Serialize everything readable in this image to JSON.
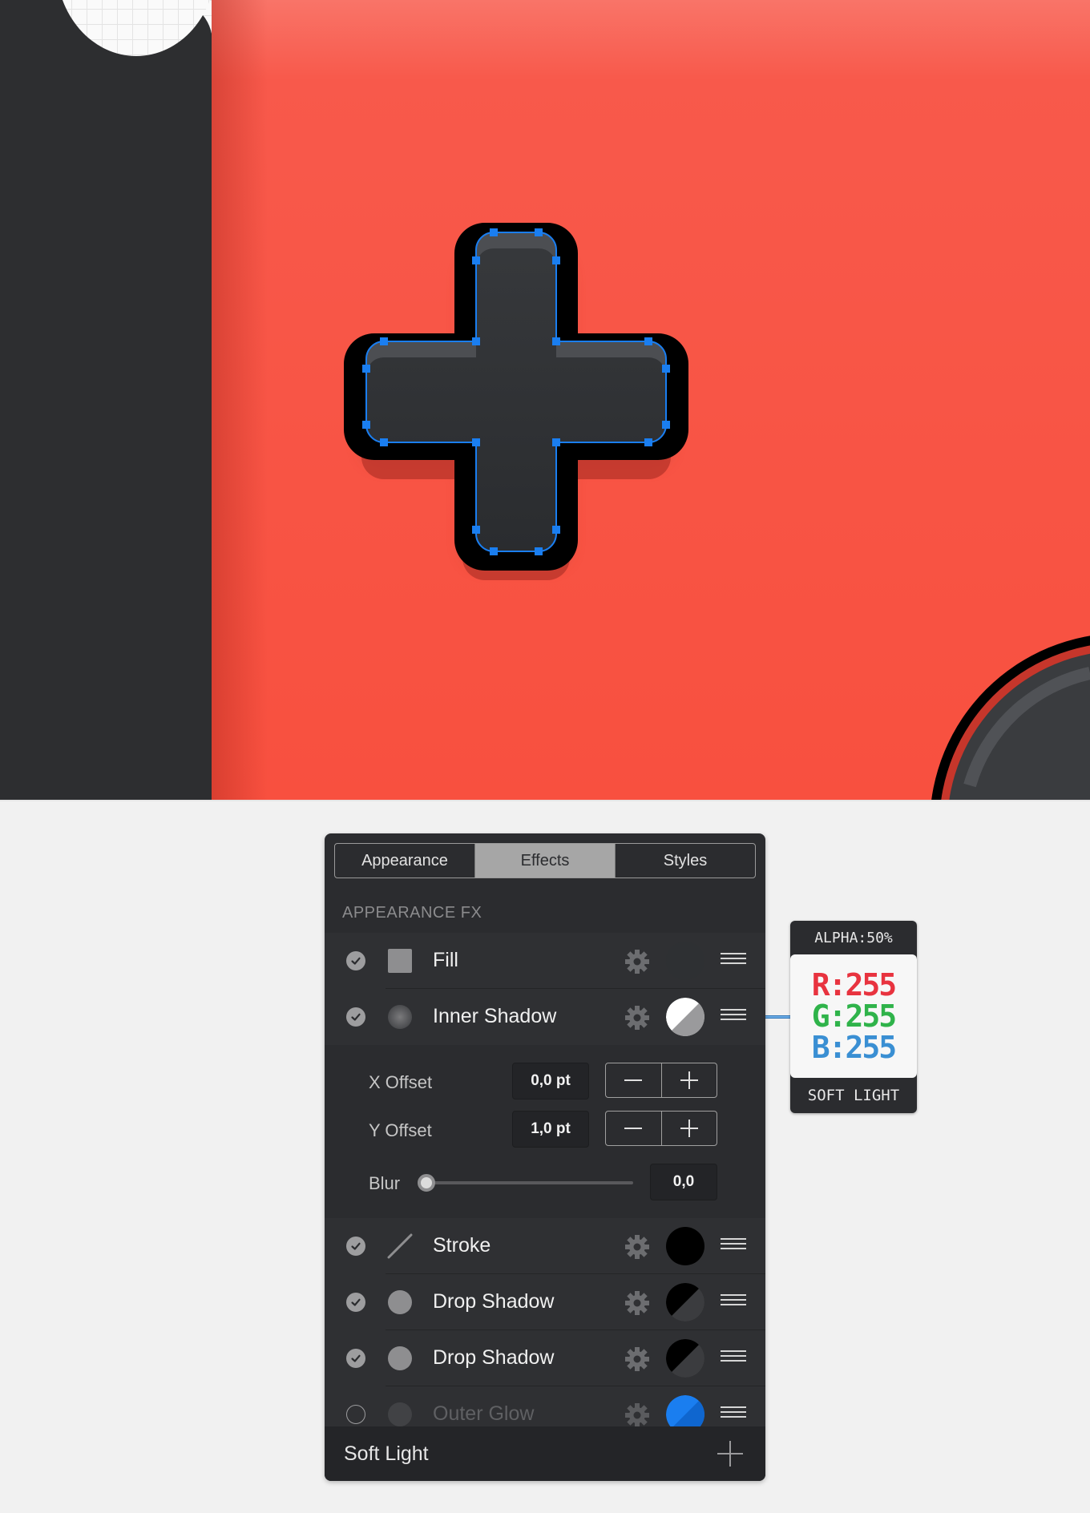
{
  "tabs": [
    {
      "label": "Appearance",
      "active": false
    },
    {
      "label": "Effects",
      "active": true
    },
    {
      "label": "Styles",
      "active": false
    }
  ],
  "section_label": "APPEARANCE FX",
  "fx_rows": [
    {
      "label": "Fill",
      "enabled": true,
      "icon": "square-icon",
      "swatch": "#2e3033"
    },
    {
      "label": "Inner Shadow",
      "enabled": true,
      "icon": "circle-icon",
      "swatch": "#ffffff"
    },
    {
      "label": "Stroke",
      "enabled": true,
      "icon": "line-icon",
      "swatch": "#000000"
    },
    {
      "label": "Drop Shadow",
      "enabled": true,
      "icon": "circle-icon",
      "swatch": "#000000"
    },
    {
      "label": "Drop Shadow",
      "enabled": true,
      "icon": "circle-icon",
      "swatch": "#000000"
    },
    {
      "label": "Outer Glow",
      "enabled": false,
      "icon": "circle-icon",
      "swatch": "#1a7ef0"
    }
  ],
  "inner_shadow": {
    "x_offset_label": "X Offset",
    "x_offset_value": "0,0 pt",
    "y_offset_label": "Y Offset",
    "y_offset_value": "1,0 pt",
    "blur_label": "Blur",
    "blur_value": "0,0",
    "blur_fraction": 0
  },
  "footer": {
    "blend_mode": "Soft Light"
  },
  "callout": {
    "alpha": "ALPHA:50%",
    "r": "R:255",
    "g": "G:255",
    "b": "B:255",
    "blend": "SOFT LIGHT"
  },
  "colors": {
    "canvas_red": "#f8503f",
    "dpad_fill": "#2e3033",
    "selection_blue": "#1a7ef0",
    "panel_bg": "#2b2c2f"
  }
}
